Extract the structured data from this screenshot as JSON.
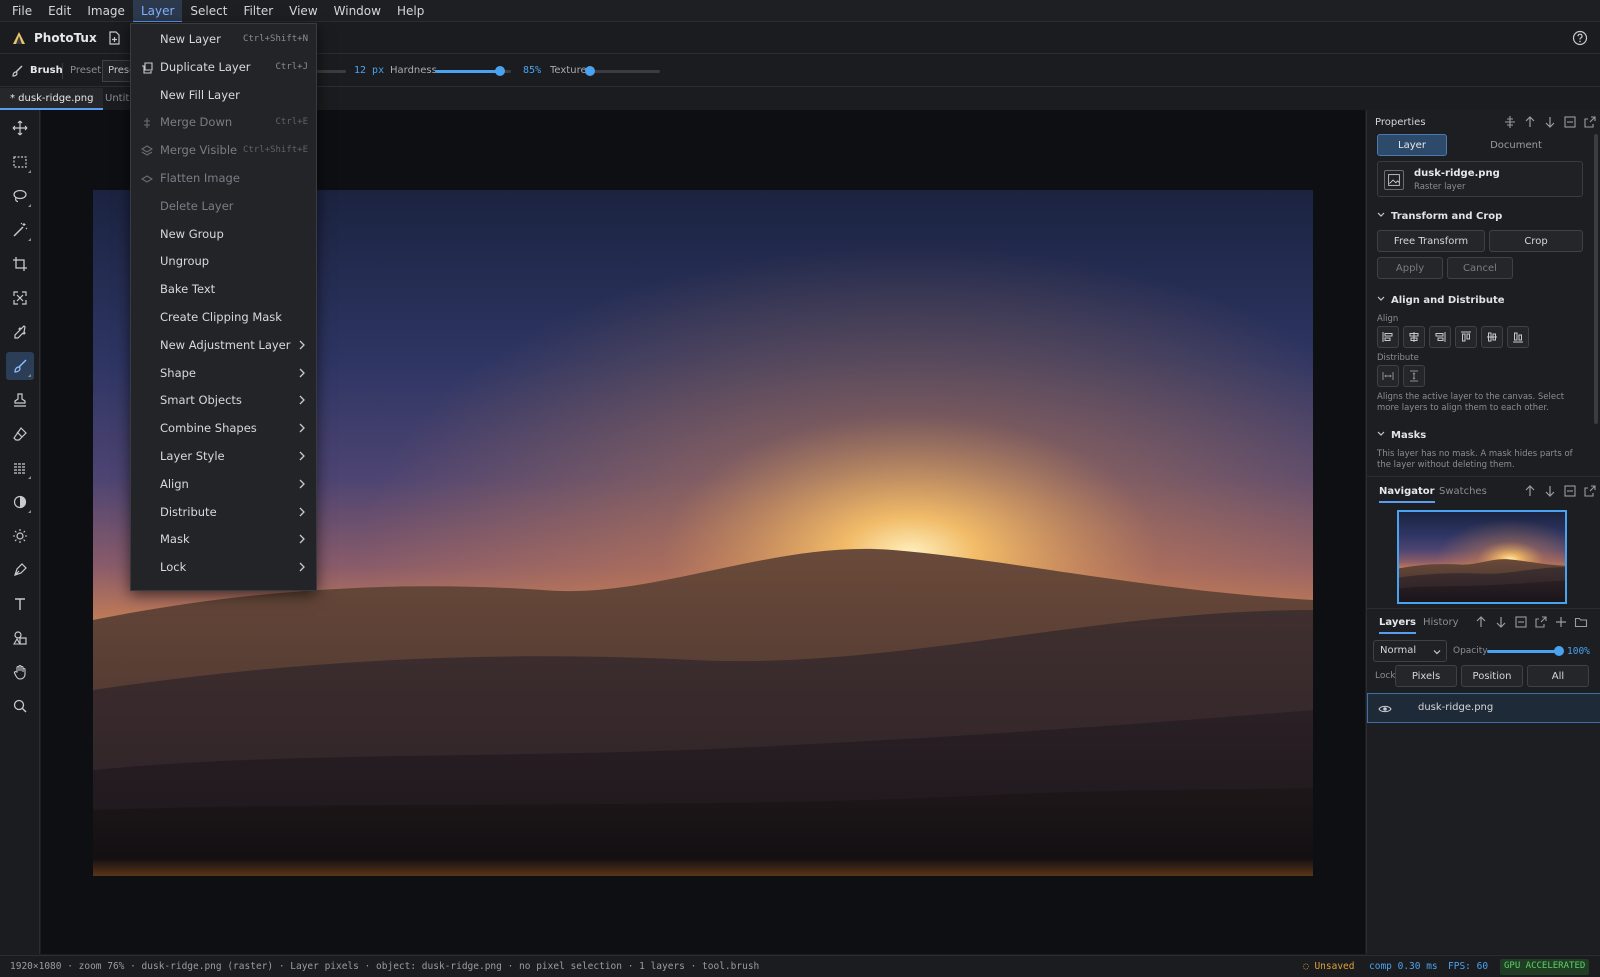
{
  "menubar": {
    "items": [
      "File",
      "Edit",
      "Image",
      "Layer",
      "Select",
      "Filter",
      "View",
      "Window",
      "Help"
    ],
    "active_index": 3
  },
  "app": {
    "title": "PhotoTux"
  },
  "options": {
    "tool_name": "Brush",
    "preset_label": "Preset",
    "preset_value": "Preset",
    "size_value": "12 px",
    "hardness_label": "Hardness",
    "hardness_value": "85%",
    "hardness_fraction": 0.85,
    "texture_label": "Texture",
    "texture_fraction": 0.0
  },
  "doc_tabs": [
    "* dusk-ridge.png",
    "Untitled"
  ],
  "layer_menu": {
    "items": [
      {
        "label": "New Layer",
        "shortcut": "Ctrl+Shift+N",
        "disabled": false,
        "icon": "",
        "submenu": false
      },
      {
        "label": "Duplicate Layer",
        "shortcut": "Ctrl+J",
        "disabled": false,
        "icon": "duplicate-icon",
        "submenu": false
      },
      {
        "label": "New Fill Layer",
        "shortcut": "",
        "disabled": false,
        "icon": "",
        "submenu": false
      },
      {
        "label": "Merge Down",
        "shortcut": "Ctrl+E",
        "disabled": true,
        "icon": "merge-down-icon",
        "submenu": false
      },
      {
        "label": "Merge Visible",
        "shortcut": "Ctrl+Shift+E",
        "disabled": true,
        "icon": "layers-icon",
        "submenu": false
      },
      {
        "label": "Flatten Image",
        "shortcut": "",
        "disabled": true,
        "icon": "flatten-icon",
        "submenu": false
      },
      {
        "label": "Delete Layer",
        "shortcut": "",
        "disabled": true,
        "icon": "",
        "submenu": false
      },
      {
        "label": "New Group",
        "shortcut": "",
        "disabled": false,
        "icon": "",
        "submenu": false
      },
      {
        "label": "Ungroup",
        "shortcut": "",
        "disabled": false,
        "icon": "",
        "submenu": false
      },
      {
        "label": "Bake Text",
        "shortcut": "",
        "disabled": false,
        "icon": "",
        "submenu": false
      },
      {
        "label": "Create Clipping Mask",
        "shortcut": "",
        "disabled": false,
        "icon": "",
        "submenu": false
      },
      {
        "label": "New Adjustment Layer",
        "shortcut": "",
        "disabled": false,
        "icon": "",
        "submenu": true
      },
      {
        "label": "Shape",
        "shortcut": "",
        "disabled": false,
        "icon": "",
        "submenu": true
      },
      {
        "label": "Smart Objects",
        "shortcut": "",
        "disabled": false,
        "icon": "",
        "submenu": true
      },
      {
        "label": "Combine Shapes",
        "shortcut": "",
        "disabled": false,
        "icon": "",
        "submenu": true
      },
      {
        "label": "Layer Style",
        "shortcut": "",
        "disabled": false,
        "icon": "",
        "submenu": true
      },
      {
        "label": "Align",
        "shortcut": "",
        "disabled": false,
        "icon": "",
        "submenu": true
      },
      {
        "label": "Distribute",
        "shortcut": "",
        "disabled": false,
        "icon": "",
        "submenu": true
      },
      {
        "label": "Mask",
        "shortcut": "",
        "disabled": false,
        "icon": "",
        "submenu": true
      },
      {
        "label": "Lock",
        "shortcut": "",
        "disabled": false,
        "icon": "",
        "submenu": true
      }
    ]
  },
  "properties": {
    "title": "Properties",
    "tabs": [
      "Layer",
      "Document"
    ],
    "file_name": "dusk-ridge.png",
    "file_type": "Raster layer",
    "transform_title": "Transform and Crop",
    "free_transform": "Free Transform",
    "crop": "Crop",
    "apply": "Apply",
    "cancel": "Cancel",
    "align_title": "Align and Distribute",
    "align_label": "Align",
    "distribute_label": "Distribute",
    "align_help": "Aligns the active layer to the canvas. Select more layers to align them to each other.",
    "masks_title": "Masks",
    "masks_help": "This layer has no mask. A mask hides parts of the layer without deleting them."
  },
  "navigator": {
    "tabs": [
      "Navigator",
      "Swatches"
    ]
  },
  "layers_panel": {
    "tabs": [
      "Layers",
      "History"
    ],
    "blend_mode": "Normal",
    "opacity_label": "Opacity",
    "opacity_value": "100%",
    "opacity_fraction": 1.0,
    "lock_label": "Lock",
    "lock_buttons": [
      "Pixels",
      "Position",
      "All"
    ],
    "layers": [
      {
        "name": "dusk-ridge.png",
        "visible": true
      }
    ]
  },
  "status": {
    "left": "1920×1080 · zoom 76% · dusk-ridge.png (raster) · Layer pixels · object: dusk-ridge.png · no pixel selection · 1 layers · tool.brush",
    "unsaved": "Unsaved",
    "comp": "comp 0.30 ms",
    "fps": "FPS: 60",
    "gpu": "GPU ACCELERATED"
  },
  "colors": {
    "accent": "#4aa3f0",
    "warning": "#e0a030",
    "success": "#5fd06a"
  }
}
